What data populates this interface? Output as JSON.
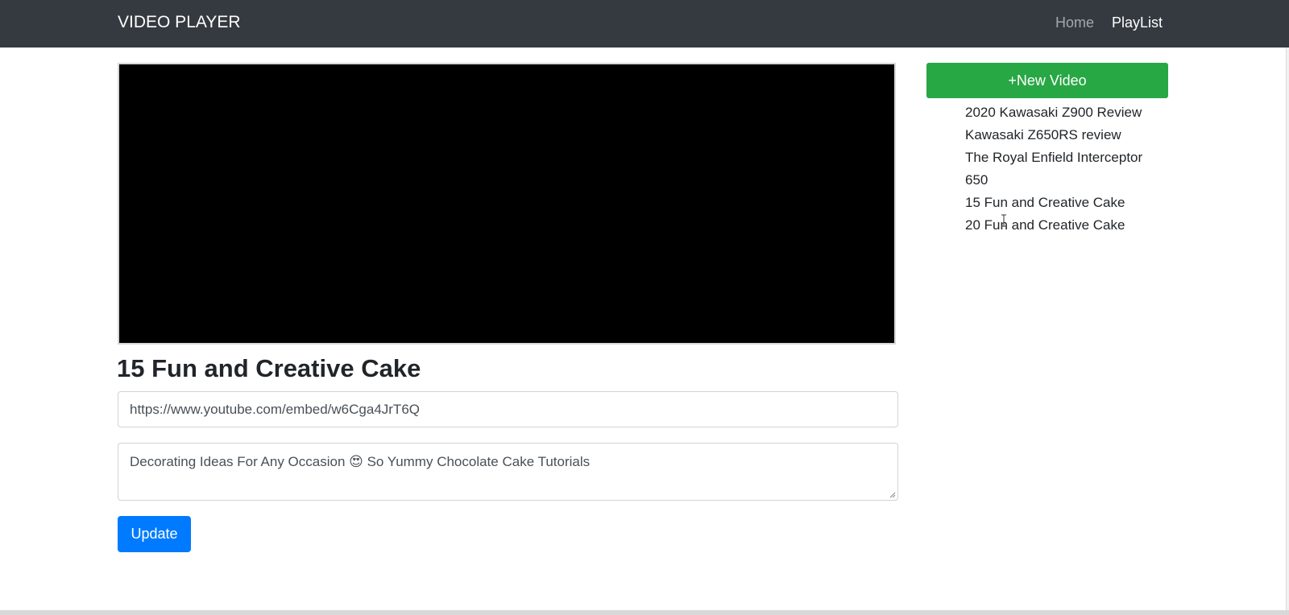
{
  "navbar": {
    "brand": "VIDEO PLAYER",
    "links": [
      {
        "label": "Home",
        "active": false
      },
      {
        "label": "PlayList",
        "active": true
      }
    ]
  },
  "player": {
    "title": "15 Fun and Creative Cake",
    "url_value": "https://www.youtube.com/embed/w6Cga4JrT6Q",
    "description_value": "Decorating Ideas For Any Occasion 😍 So Yummy Chocolate Cake Tutorials",
    "update_label": "Update"
  },
  "sidebar": {
    "new_video_label": "+New Video",
    "playlist": [
      "2020 Kawasaki Z900 Review",
      "Kawasaki Z650RS review",
      "The Royal Enfield Interceptor 650",
      "15 Fun and Creative Cake",
      "20 Fun and Creative Cake"
    ]
  },
  "colors": {
    "navbar_bg": "#343a40",
    "primary": "#007bff",
    "success": "#28a745",
    "video_bg": "#000000"
  }
}
